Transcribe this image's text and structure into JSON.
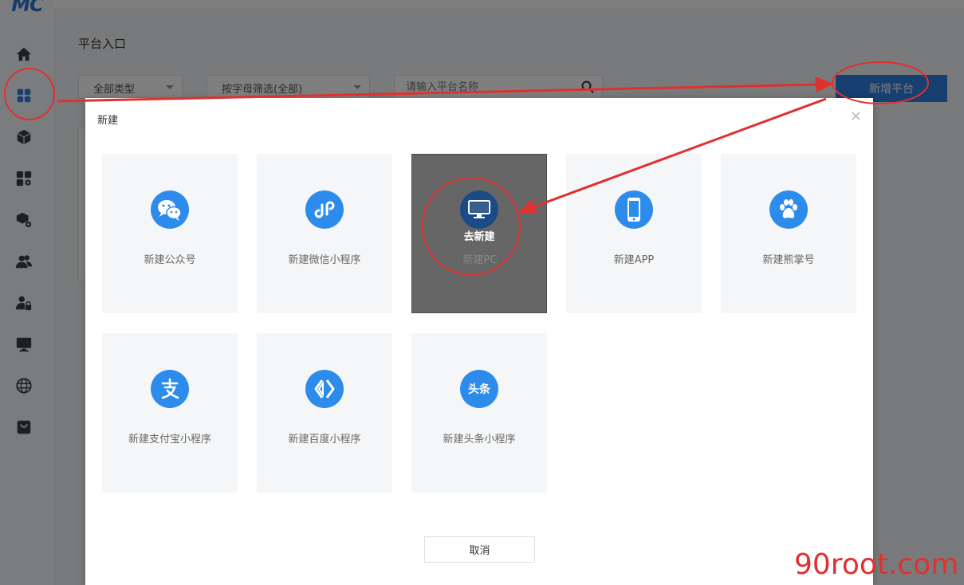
{
  "app": {
    "logo": "MC"
  },
  "sidebar": {
    "items": [
      {
        "name": "home-icon"
      },
      {
        "name": "grid-icon"
      },
      {
        "name": "cube-icon"
      },
      {
        "name": "apps-settings-icon"
      },
      {
        "name": "box-settings-icon"
      },
      {
        "name": "users-icon"
      },
      {
        "name": "user-lock-icon"
      },
      {
        "name": "monitor-icon"
      },
      {
        "name": "globe-icon"
      },
      {
        "name": "bag-icon"
      }
    ]
  },
  "page": {
    "title": "平台入口"
  },
  "filters": {
    "type_label": "全部类型",
    "letter_label": "按字母筛选(全部)",
    "search_placeholder": "请输入平台名称"
  },
  "toolbar": {
    "add_platform_label": "新增平台"
  },
  "modal": {
    "title": "新建",
    "close_label": "×",
    "tiles": [
      {
        "label": "新建公众号",
        "icon": "wechat-icon"
      },
      {
        "label": "新建微信小程序",
        "icon": "mini-program-icon"
      },
      {
        "label": "新建PC",
        "icon": "monitor-icon",
        "hover_label": "去新建"
      },
      {
        "label": "新建APP",
        "icon": "phone-icon"
      },
      {
        "label": "新建熊掌号",
        "icon": "paw-icon"
      },
      {
        "label": "新建支付宝小程序",
        "icon": "alipay-icon"
      },
      {
        "label": "新建百度小程序",
        "icon": "baidu-icon"
      },
      {
        "label": "新建头条小程序",
        "icon": "toutiao-icon",
        "icon_text": "头条"
      }
    ],
    "cancel_label": "取消"
  },
  "watermark": "90root.com",
  "colors": {
    "accent": "#2d8ceb",
    "annotation": "#e03030"
  }
}
